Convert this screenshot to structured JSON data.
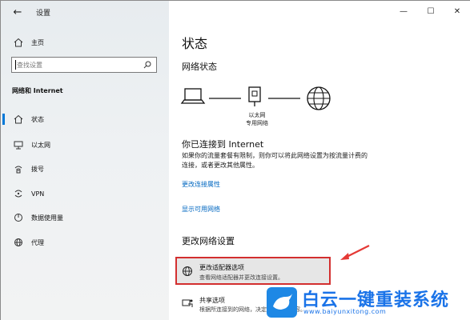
{
  "window": {
    "app_title": "设置",
    "minimize": "—",
    "maximize": "☐",
    "close": "✕"
  },
  "sidebar": {
    "home": "主页",
    "search_placeholder": "查找设置",
    "section": "网络和 Internet",
    "items": [
      {
        "label": "状态",
        "icon": "home-network-icon"
      },
      {
        "label": "以太网",
        "icon": "ethernet-icon"
      },
      {
        "label": "拨号",
        "icon": "dialup-icon"
      },
      {
        "label": "VPN",
        "icon": "vpn-icon"
      },
      {
        "label": "数据使用量",
        "icon": "data-usage-icon"
      },
      {
        "label": "代理",
        "icon": "globe-icon"
      }
    ]
  },
  "main": {
    "title": "状态",
    "network_status_heading": "网络状态",
    "diagram_caption_1": "以太网",
    "diagram_caption_2": "专用网络",
    "connected_heading": "你已连接到 Internet",
    "connected_text_1": "如果你的流量套餐有限制，则你可以将此网络设置为按流量计费的",
    "connected_text_2": "连接，或者更改其他属性。",
    "link_change_props": "更改连接属性",
    "link_show_networks": "显示可用网络",
    "change_settings_heading": "更改网络设置",
    "adapter_title": "更改适配器选项",
    "adapter_desc": "查看网络适配器并更改连接设置。",
    "share_title": "共享选项",
    "share_desc": "根据所连接到的网络，决定要共享的内容。"
  },
  "watermark": {
    "name": "白云一键重装系统",
    "url": "www.baiyunxitong.com"
  },
  "colors": {
    "accent": "#0078d7",
    "link": "#0067c0",
    "highlight_border": "#d32f2f"
  }
}
